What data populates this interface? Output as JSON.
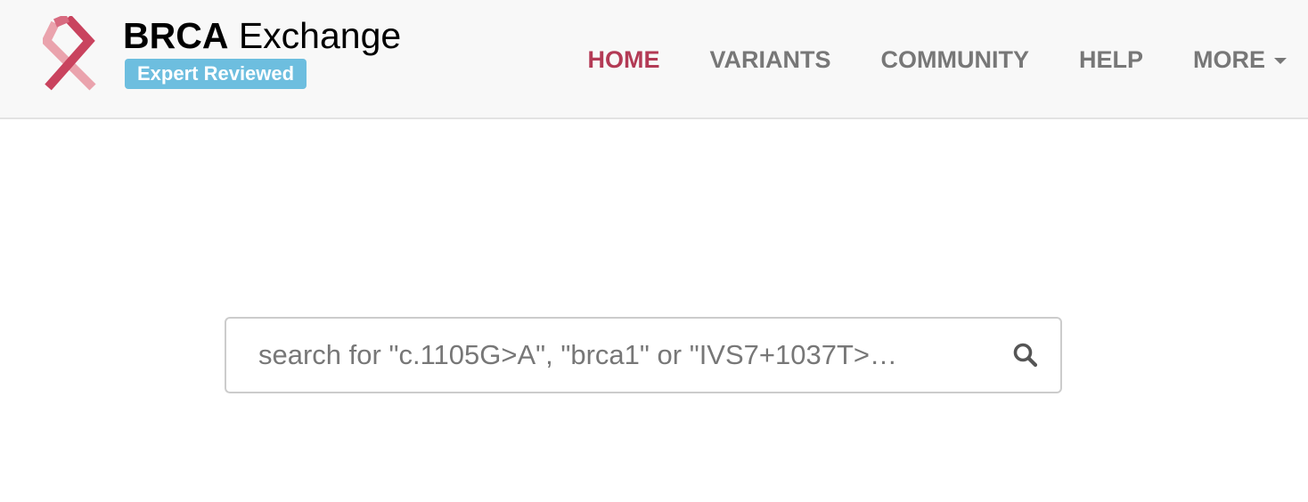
{
  "brand": {
    "name_bold": "BRCA",
    "name_rest": " Exchange",
    "badge": "Expert Reviewed",
    "logo_icon": "ribbon-icon",
    "badge_color": "#6dbedf",
    "logo_colors": [
      "#c9435e",
      "#eaa3ad"
    ]
  },
  "nav": {
    "items": [
      {
        "label": "HOME",
        "active": true
      },
      {
        "label": "VARIANTS",
        "active": false
      },
      {
        "label": "COMMUNITY",
        "active": false
      },
      {
        "label": "HELP",
        "active": false
      },
      {
        "label": "MORE",
        "active": false,
        "dropdown": true
      }
    ],
    "active_color": "#b33a55",
    "text_color": "#777777"
  },
  "search": {
    "placeholder": "search for \"c.1105G>A\", \"brca1\" or \"IVS7+1037T>…",
    "value": "",
    "button_icon": "search-icon"
  }
}
